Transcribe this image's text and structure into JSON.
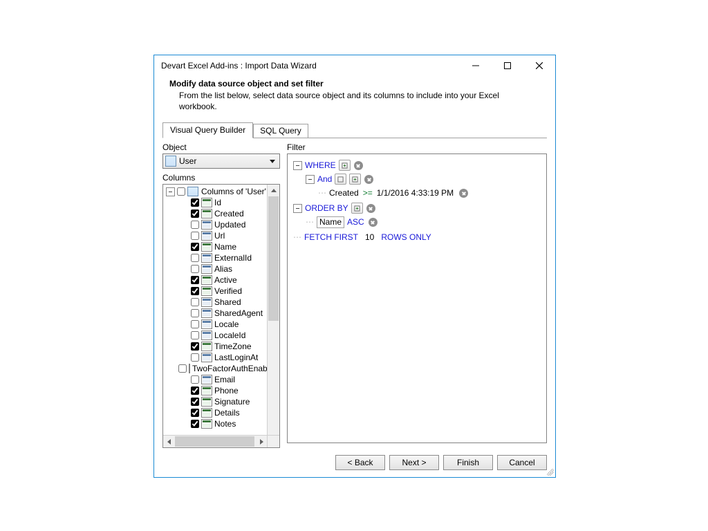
{
  "window": {
    "title": "Devart Excel Add-ins : Import Data Wizard"
  },
  "header": {
    "title": "Modify data source object and set filter",
    "description": "From the list below, select data source object and its columns to include into your Excel workbook."
  },
  "tabs": {
    "visual": "Visual Query Builder",
    "sql": "SQL Query"
  },
  "object": {
    "label": "Object",
    "value": "User"
  },
  "columns": {
    "label": "Columns",
    "root": "Columns of 'User'",
    "items": [
      {
        "name": "Id",
        "checked": true
      },
      {
        "name": "Created",
        "checked": true
      },
      {
        "name": "Updated",
        "checked": false
      },
      {
        "name": "Url",
        "checked": false
      },
      {
        "name": "Name",
        "checked": true
      },
      {
        "name": "ExternalId",
        "checked": false
      },
      {
        "name": "Alias",
        "checked": false
      },
      {
        "name": "Active",
        "checked": true
      },
      {
        "name": "Verified",
        "checked": true
      },
      {
        "name": "Shared",
        "checked": false
      },
      {
        "name": "SharedAgent",
        "checked": false
      },
      {
        "name": "Locale",
        "checked": false
      },
      {
        "name": "LocaleId",
        "checked": false
      },
      {
        "name": "TimeZone",
        "checked": true
      },
      {
        "name": "LastLoginAt",
        "checked": false
      },
      {
        "name": "TwoFactorAuthEnabled",
        "checked": false
      },
      {
        "name": "Email",
        "checked": false
      },
      {
        "name": "Phone",
        "checked": true
      },
      {
        "name": "Signature",
        "checked": true
      },
      {
        "name": "Details",
        "checked": true
      },
      {
        "name": "Notes",
        "checked": true
      }
    ]
  },
  "filter": {
    "label": "Filter",
    "where_kw": "WHERE",
    "and_kw": "And",
    "cond_field": "Created",
    "cond_op": ">=",
    "cond_value": "1/1/2016 4:33:19 PM",
    "orderby_kw": "ORDER BY",
    "order_field": "Name",
    "order_dir": "ASC",
    "fetch_first_kw": "FETCH FIRST",
    "fetch_count": "10",
    "rows_only_kw": "ROWS ONLY"
  },
  "buttons": {
    "back": "< Back",
    "next": "Next >",
    "finish": "Finish",
    "cancel": "Cancel"
  }
}
